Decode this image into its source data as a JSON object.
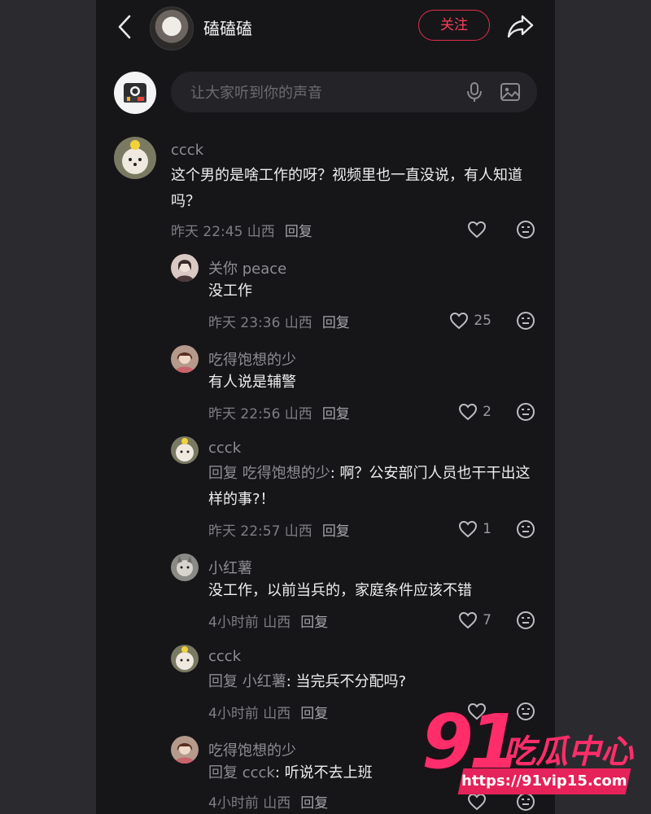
{
  "header": {
    "title": "磕磕磕",
    "follow_label": "关注"
  },
  "composer": {
    "placeholder": "让大家听到你的声音"
  },
  "comments": [
    {
      "name": "ccck",
      "text": "这个男的是啥工作的呀？视频里也一直没说，有人知道吗？",
      "time": "昨天 22:45 山西",
      "reply_label": "回复",
      "likes": ""
    },
    {
      "name": "关你 peace",
      "text": "没工作",
      "time": "昨天 23:36 山西",
      "reply_label": "回复",
      "likes": "25"
    },
    {
      "name": "吃得饱想的少",
      "text": "有人说是辅警",
      "time": "昨天 22:56 山西",
      "reply_label": "回复",
      "likes": "2"
    },
    {
      "name": "ccck",
      "reply_prefix": "回复 ",
      "reply_to": "吃得饱想的少",
      "text": ": 啊？公安部门人员也干干出这样的事?！",
      "time": "昨天 22:57 山西",
      "reply_label": "回复",
      "likes": "1"
    },
    {
      "name": "小红薯",
      "text": "没工作，以前当兵的，家庭条件应该不错",
      "time": "4小时前 山西",
      "reply_label": "回复",
      "likes": "7"
    },
    {
      "name": "ccck",
      "reply_prefix": "回复 ",
      "reply_to": "小红薯",
      "text": ": 当完兵不分配吗?",
      "time": "4小时前 山西",
      "reply_label": "回复",
      "likes": ""
    },
    {
      "name": "吃得饱想的少",
      "reply_prefix": "回复 ",
      "reply_to": "ccck",
      "text": ": 听说不去上班",
      "time": "4小时前 山西",
      "reply_label": "回复",
      "likes": ""
    }
  ],
  "watermark": {
    "number": "91",
    "brand": "吃瓜中心",
    "url": "https://91vip15.com"
  },
  "colors": {
    "accent": "#ff3d5a",
    "background": "#161619"
  }
}
